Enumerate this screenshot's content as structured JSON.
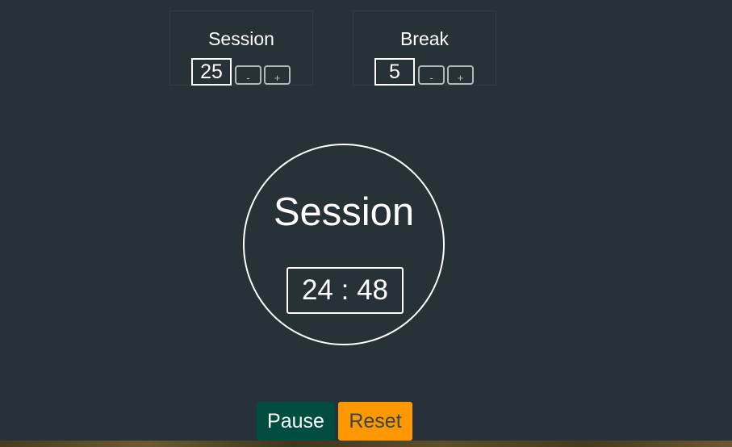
{
  "session_setting": {
    "title": "Session",
    "value": "25",
    "decrement_label": "-",
    "increment_label": "+"
  },
  "break_setting": {
    "title": "Break",
    "value": "5",
    "decrement_label": "-",
    "increment_label": "+"
  },
  "timer": {
    "label": "Session",
    "time": "24 : 48"
  },
  "controls": {
    "pause_label": "Pause",
    "reset_label": "Reset"
  },
  "colors": {
    "background": "#263238",
    "pause_button": "#014d40",
    "reset_button": "#ff9800"
  }
}
